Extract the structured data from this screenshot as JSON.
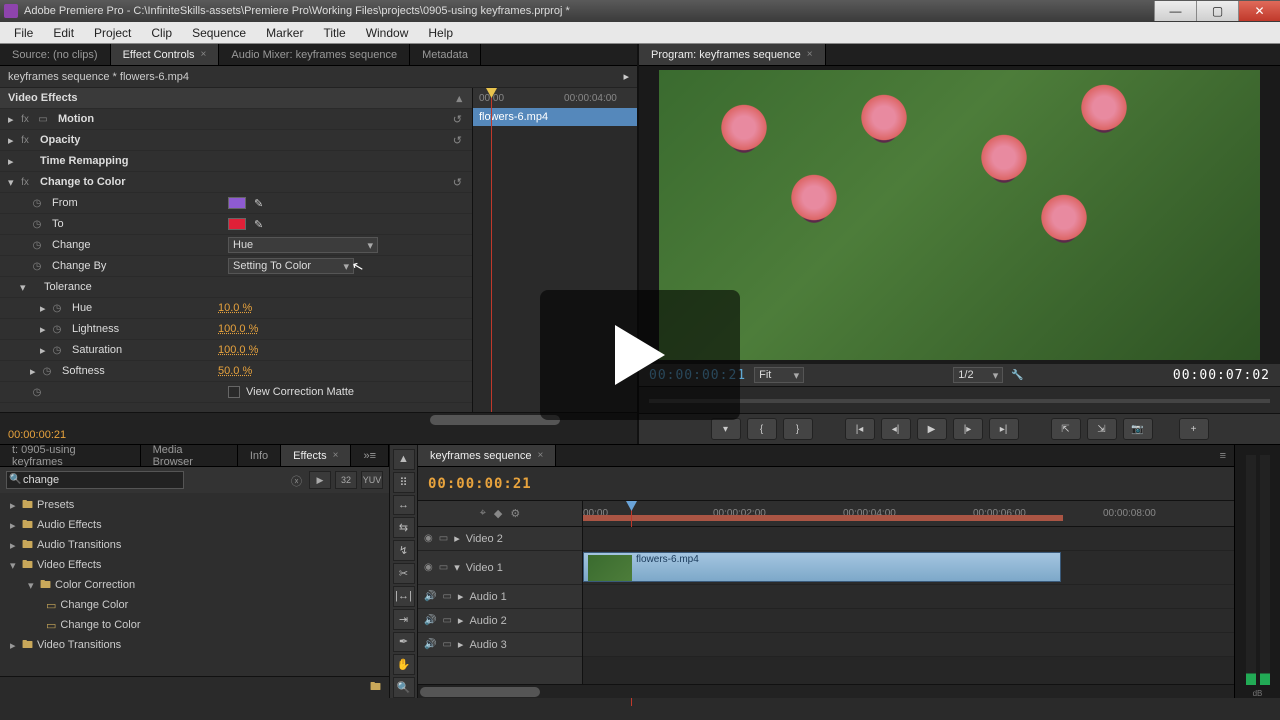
{
  "title": "Adobe Premiere Pro - C:\\InfiniteSkills-assets\\Premiere Pro\\Working Files\\projects\\0905-using keyframes.prproj *",
  "menu": [
    "File",
    "Edit",
    "Project",
    "Clip",
    "Sequence",
    "Marker",
    "Title",
    "Window",
    "Help"
  ],
  "topTabsLeft": {
    "source": "Source: (no clips)",
    "fx": "Effect Controls",
    "mixer": "Audio Mixer: keyframes sequence",
    "meta": "Metadata"
  },
  "program": {
    "tab": "Program: keyframes sequence",
    "tcLeft": "00:00:00:21",
    "tcRight": "00:00:07:02",
    "fit": "Fit",
    "zoom": "1/2"
  },
  "fx": {
    "clipPath": "keyframes sequence * flowers-6.mp4",
    "sectionTitle": "Video Effects",
    "motion": "Motion",
    "opacity": "Opacity",
    "timeremap": "Time Remapping",
    "changeColor": "Change to Color",
    "from": "From",
    "to": "To",
    "change": "Change",
    "changeBy": "Change By",
    "tolerance": "Tolerance",
    "hue": "Hue",
    "lightness": "Lightness",
    "saturation": "Saturation",
    "softness": "Softness",
    "hueVal": "10.0 %",
    "lightVal": "100.0 %",
    "satVal": "100.0 %",
    "softVal": "50.0 %",
    "changeOpt": "Hue",
    "changeByOpt": "Setting To Color",
    "viewMatte": "View Correction Matte",
    "fromColor": "#8e5bd1",
    "toColor": "#e02038",
    "rulerA": "00:00",
    "rulerB": "00:00:04:00",
    "clipLabel": "flowers-6.mp4",
    "bottomTc": "00:00:00:21"
  },
  "effectsPanel": {
    "tabs": {
      "proj": "t: 0905-using keyframes",
      "media": "Media Browser",
      "info": "Info",
      "fx": "Effects"
    },
    "search": "change",
    "tree": {
      "presets": "Presets",
      "audiofx": "Audio Effects",
      "audiotr": "Audio Transitions",
      "videofx": "Video Effects",
      "cc": "Color Correction",
      "ccChange": "Change Color",
      "ccChangeTo": "Change to Color",
      "videotr": "Video Transitions"
    }
  },
  "timeline": {
    "tab": "keyframes sequence",
    "tc": "00:00:00:21",
    "ruler": [
      "00:00",
      "00:00:02:00",
      "00:00:04:00",
      "00:00:06:00",
      "00:00:08:00"
    ],
    "tracks": {
      "v2": "Video 2",
      "v1": "Video 1",
      "a1": "Audio 1",
      "a2": "Audio 2",
      "a3": "Audio 3"
    },
    "clipName": "flowers-6.mp4"
  }
}
